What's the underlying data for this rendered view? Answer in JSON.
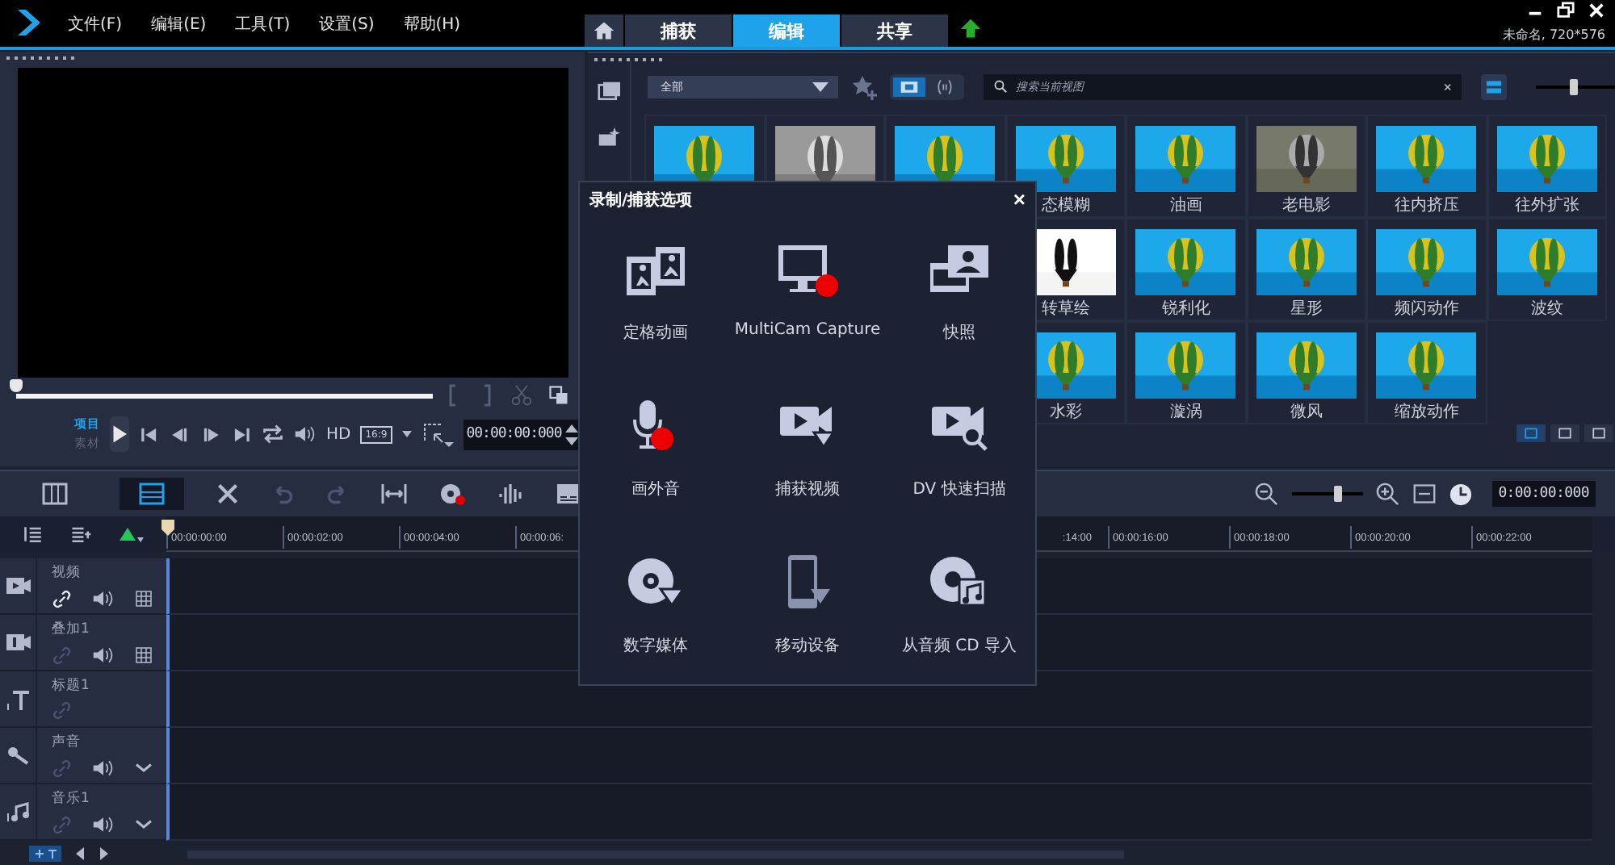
{
  "menu": [
    "文件(F)",
    "编辑(E)",
    "工具(T)",
    "设置(S)",
    "帮助(H)"
  ],
  "tabs": [
    {
      "label": "捕获",
      "selected": false
    },
    {
      "label": "编辑",
      "selected": true
    },
    {
      "label": "共享",
      "selected": false
    }
  ],
  "project_info": "未命名, 720*576",
  "preview": {
    "scrubber": {
      "level": 0
    },
    "modes": [
      {
        "label": "项目",
        "selected": true
      },
      {
        "label": "素材",
        "selected": false
      }
    ],
    "hd": "HD",
    "aspect": "16:9",
    "timecode": "00:00:00:000"
  },
  "library": {
    "category": "全部",
    "filters": [
      {
        "selected": true
      },
      {
        "selected": false
      }
    ],
    "search": {
      "placeholder": "搜索当前视图"
    },
    "clear": "×",
    "size_slider": {
      "level": 0.45
    },
    "effects": [
      [
        {
          "kind": "picture"
        },
        {
          "kind": "picture"
        },
        {
          "kind": "picture"
        },
        {
          "kind": "picture",
          "label": "态模糊"
        },
        {
          "kind": "picture",
          "label": "油画"
        },
        {
          "kind": "picture",
          "label": "老电影"
        },
        {
          "kind": "picture",
          "label": "往内挤压"
        },
        {
          "kind": "picture",
          "label": "往外扩张"
        }
      ],
      [
        {
          "kind": "picture",
          "label": "转草绘"
        },
        {
          "kind": "picture",
          "label": "锐利化"
        },
        {
          "kind": "picture",
          "label": "星形"
        },
        {
          "kind": "picture",
          "label": "频闪动作"
        },
        {
          "kind": "picture",
          "label": "波纹"
        }
      ],
      [
        {
          "kind": "picture",
          "label": "水彩"
        },
        {
          "kind": "picture",
          "label": "漩涡"
        },
        {
          "kind": "picture",
          "label": "微风"
        },
        {
          "kind": "picture",
          "label": "缩放动作"
        }
      ]
    ],
    "layout_buttons": [
      {
        "selected": true
      },
      {
        "selected": false
      },
      {
        "selected": false
      }
    ]
  },
  "dialog": {
    "title": "录制/捕获选项",
    "close": "×",
    "options": [
      "定格动画",
      "MultiCam Capture",
      "快照",
      "画外音",
      "捕获视频",
      "DV 快速扫描",
      "数字媒体",
      "移动设备",
      "从音频 CD 导入"
    ]
  },
  "timeline": {
    "views": [
      {
        "selected": false
      },
      {
        "selected": true
      }
    ],
    "zoom": {
      "level": 0.65
    },
    "timecode": "0:00:00:000",
    "ruler_left": [
      "00:00:00:00",
      "00:00:02:00",
      "00:00:04:00",
      "00:00:06:"
    ],
    "ruler_right": [
      ":14:00",
      "00:00:16:00",
      "00:00:18:00",
      "00:00:20:00",
      "00:00:22:00"
    ],
    "tracks": [
      {
        "kind": "video",
        "name": "视频",
        "link_on": true
      },
      {
        "kind": "overlay",
        "name": "叠加1",
        "link_on": false
      },
      {
        "kind": "title",
        "name": "标题1",
        "link_on": false
      },
      {
        "kind": "voice",
        "name": "声音",
        "link_on": false
      },
      {
        "kind": "music",
        "name": "音乐1",
        "link_on": false
      }
    ]
  }
}
